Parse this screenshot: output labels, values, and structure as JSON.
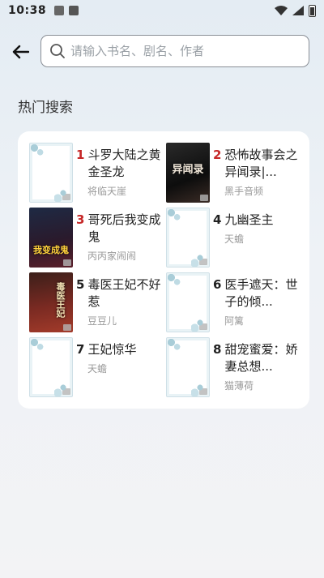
{
  "status_bar": {
    "time": "10:38"
  },
  "search": {
    "placeholder": "请输入书名、剧名、作者",
    "value": ""
  },
  "section": {
    "title": "热门搜索"
  },
  "hot_books": [
    {
      "rank": "1",
      "title": "斗罗大陆之黄金圣龙",
      "author": "将临天崖",
      "cover": "placeholder"
    },
    {
      "rank": "2",
      "title": "恐怖故事会之异闻录|...",
      "author": "黑手音频",
      "cover": "dark1",
      "cover_text": "异闻录"
    },
    {
      "rank": "3",
      "title": "哥死后我变成鬼",
      "author": "丙丙家闹闹",
      "cover": "dark2",
      "cover_text": "我变成鬼"
    },
    {
      "rank": "4",
      "title": "九幽圣主",
      "author": "天蟾",
      "cover": "placeholder"
    },
    {
      "rank": "5",
      "title": "毒医王妃不好惹",
      "author": "豆豆儿",
      "cover": "dark3",
      "cover_text": "毒医王妃"
    },
    {
      "rank": "6",
      "title": "医手遮天：世子的倾...",
      "author": "阿篱",
      "cover": "placeholder"
    },
    {
      "rank": "7",
      "title": "王妃惊华",
      "author": "天蟾",
      "cover": "placeholder"
    },
    {
      "rank": "8",
      "title": "甜宠蜜爱：娇妻总想...",
      "author": "猫薄荷",
      "cover": "placeholder"
    }
  ],
  "colors": {
    "top_rank": "#c62828",
    "author_text": "#9a9a9a"
  }
}
